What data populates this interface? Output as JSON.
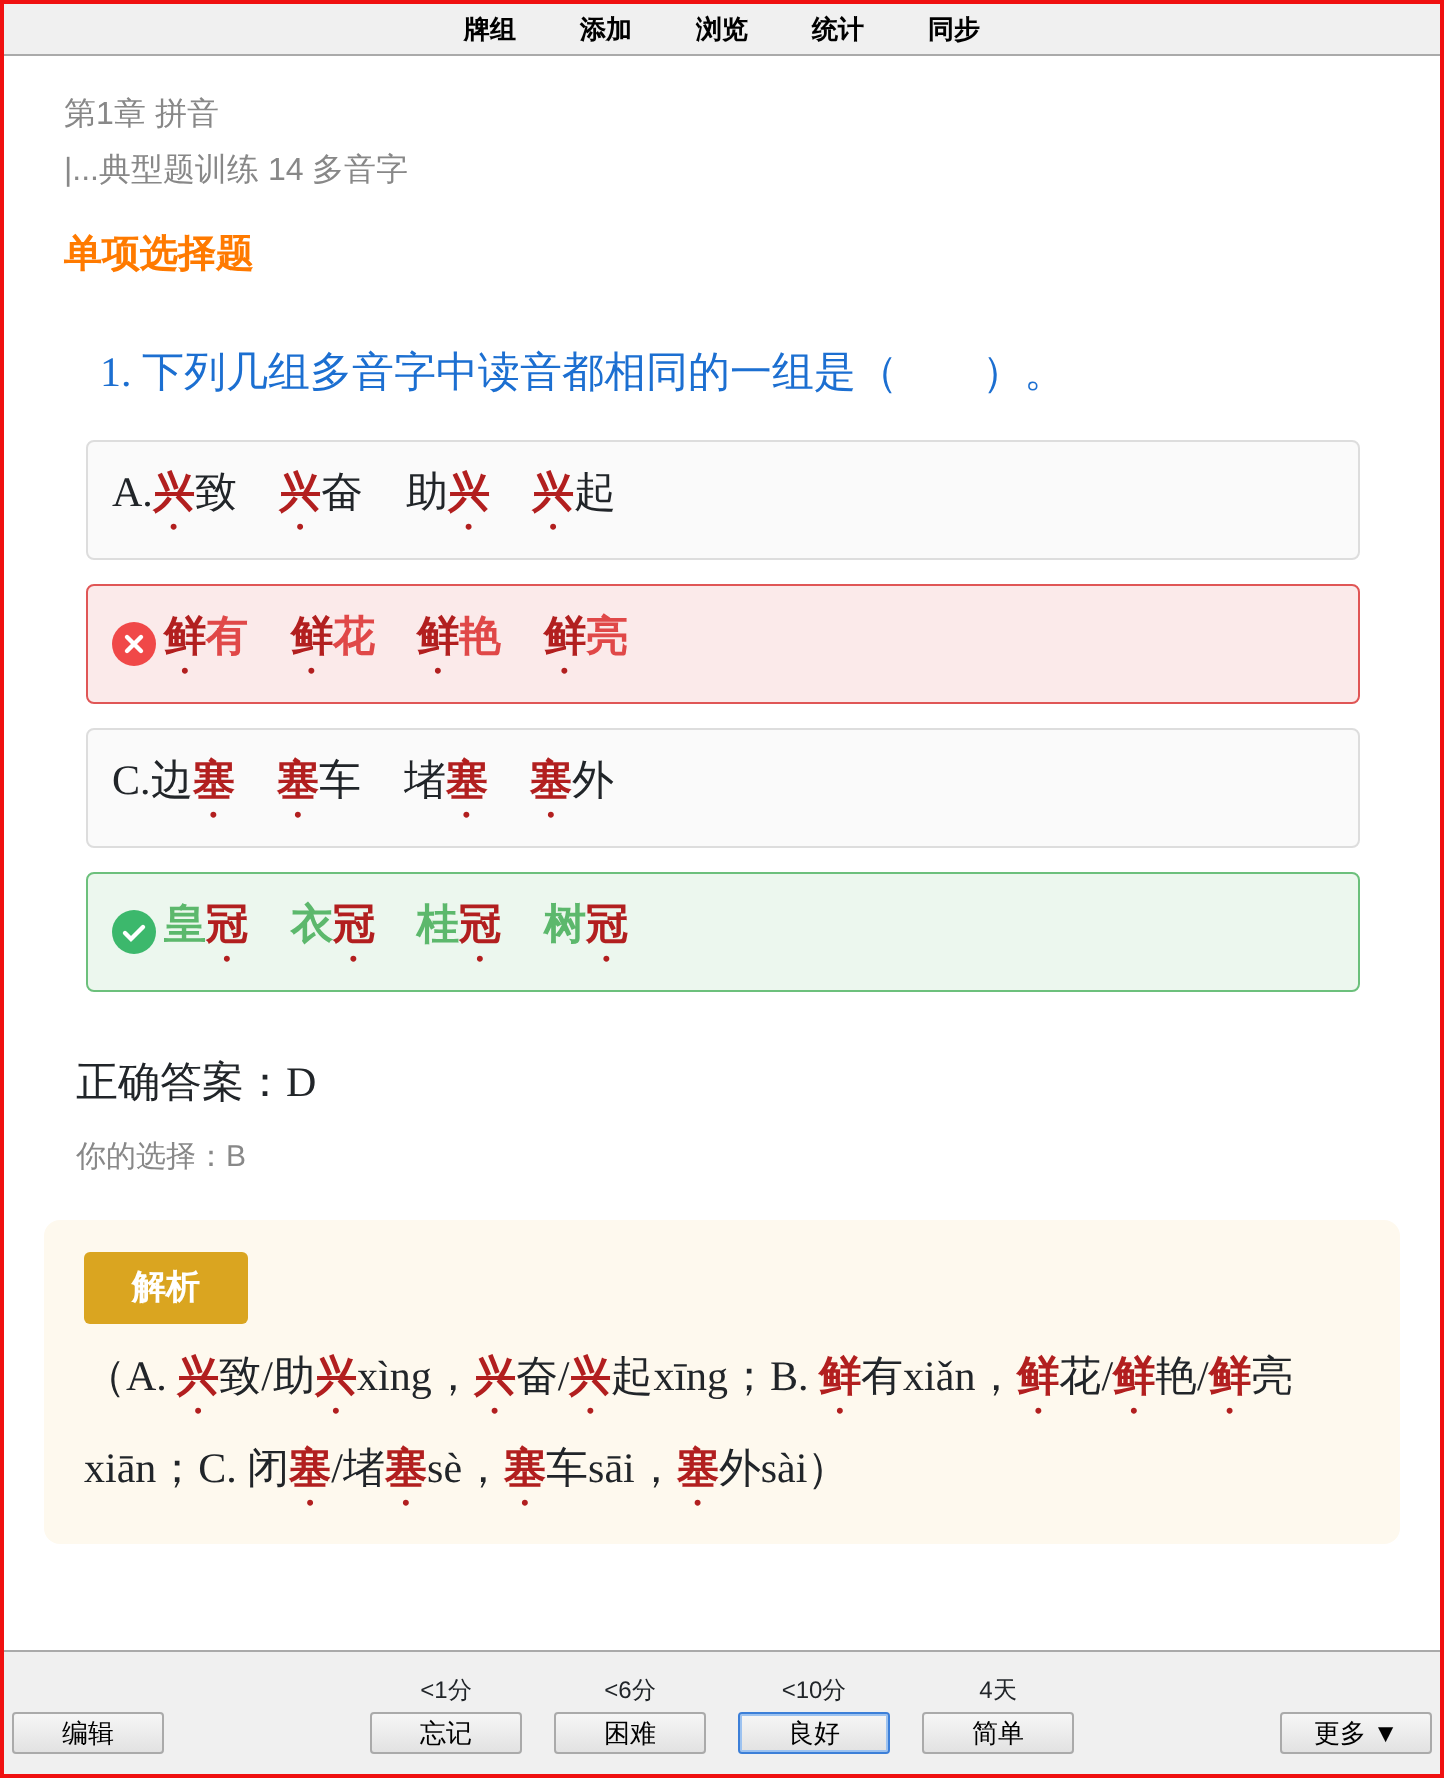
{
  "menu": [
    {
      "label": "牌组"
    },
    {
      "label": "添加"
    },
    {
      "label": "浏览"
    },
    {
      "label": "统计"
    },
    {
      "label": "同步"
    }
  ],
  "breadcrumb": {
    "chapter": "第1章 拼音",
    "section": "|...典型题训练 14 多音字"
  },
  "section_title": "单项选择题",
  "question": {
    "number": "1.",
    "text": "下列几组多音字中读音都相同的一组是（　　）。"
  },
  "options": [
    {
      "label": "A.",
      "text": "**兴**致 **兴**奋 助**兴** **兴**起",
      "kind": "plain"
    },
    {
      "text": "**鲜**有 **鲜**花 **鲜**艳 **鲜**亮",
      "kind": "wrong"
    },
    {
      "label": "C.",
      "text": "边**塞** **塞**车 堵**塞** **塞**外",
      "kind": "plain"
    },
    {
      "text": "皇**冠** 衣**冠** 桂**冠** 树**冠**",
      "kind": "correct"
    }
  ],
  "correct_answer": "正确答案：D",
  "your_choice": "你的选择：B",
  "analysis": {
    "badge": "解析",
    "text": "（A. **兴**致/助**兴**xìng，**兴**奋/**兴**起xīng；B. **鲜**有xiǎn，**鲜**花/**鲜**艳/**鲜**亮xiān；C. 闭**塞**/堵**塞**sè，**塞**车sāi，**塞**外sài）"
  },
  "bottom_bar": {
    "edit": "编辑",
    "answers": [
      {
        "time": "<1分",
        "label": "忘记",
        "focused": false
      },
      {
        "time": "<6分",
        "label": "困难",
        "focused": false
      },
      {
        "time": "<10分",
        "label": "良好",
        "focused": true
      },
      {
        "time": "4天",
        "label": "简单",
        "focused": false
      }
    ],
    "more": "更多 ▼"
  }
}
